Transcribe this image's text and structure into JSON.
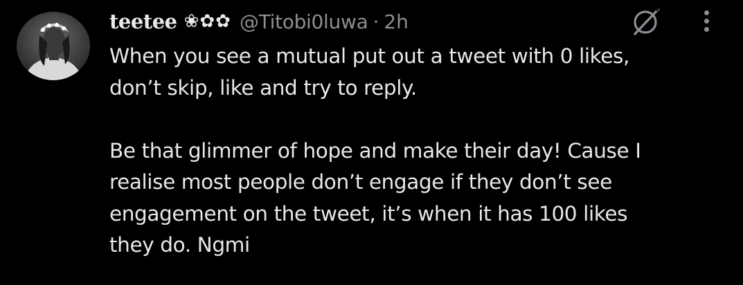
{
  "post": {
    "display_name": "teetee",
    "name_emoji": "❀✿✿",
    "handle": "@Titobi0luwa",
    "separator": "·",
    "timestamp": "2h",
    "text_paragraph_1": [
      "When you see a mutual put out a tweet with 0 likes,",
      "don’t skip, like and try to reply."
    ],
    "text_paragraph_2": [
      "Be that glimmer of hope and make their day! Cause I",
      "realise most people don’t engage if they don’t see",
      "engagement on the tweet, it’s when it has 100 likes",
      "they do. Ngmi"
    ]
  },
  "icons": {
    "avatar": "avatar",
    "grok": "grok-icon",
    "more": "more-options-icon"
  },
  "colors": {
    "background": "#000000",
    "primary_text": "#e7e9ea",
    "secondary_text": "#8b8f94"
  }
}
